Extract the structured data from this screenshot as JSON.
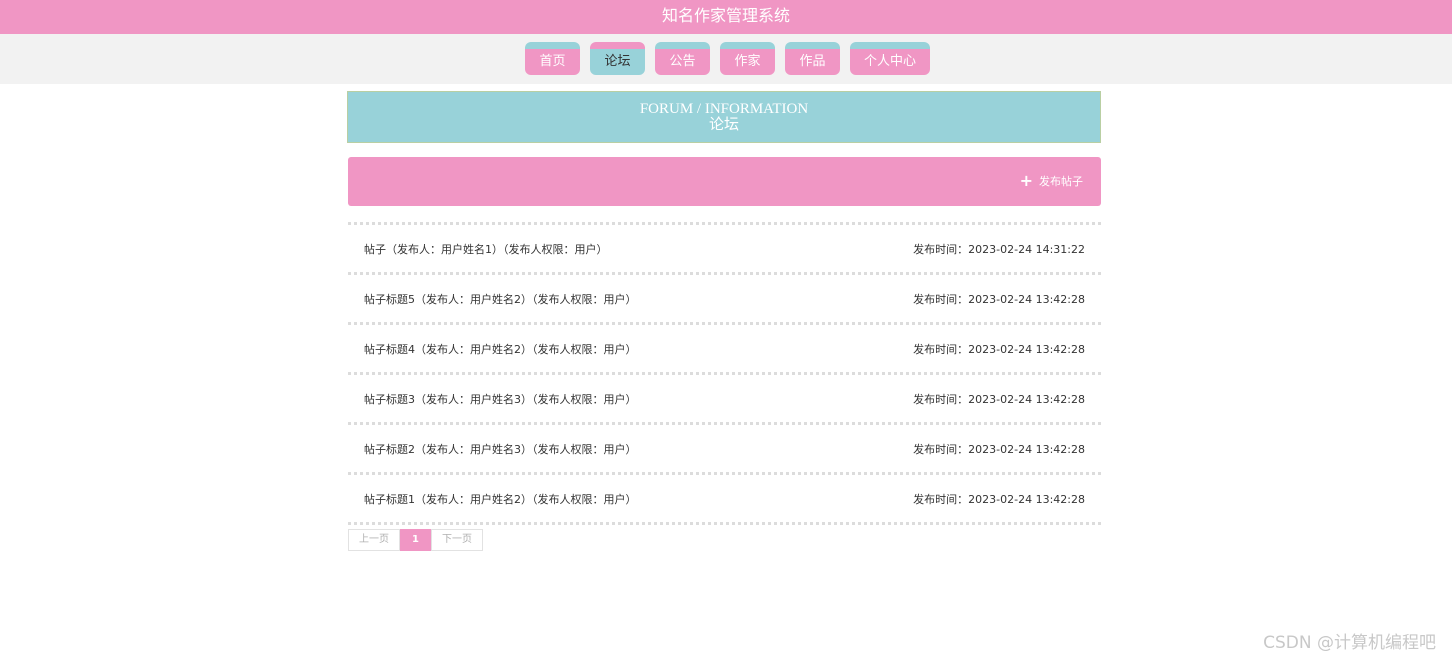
{
  "header": {
    "title": "知名作家管理系统"
  },
  "nav": {
    "items": [
      {
        "label": "首页",
        "active": false
      },
      {
        "label": "论坛",
        "active": true
      },
      {
        "label": "公告",
        "active": false
      },
      {
        "label": "作家",
        "active": false
      },
      {
        "label": "作品",
        "active": false
      },
      {
        "label": "个人中心",
        "active": false
      }
    ]
  },
  "banner": {
    "title_en": "FORUM / INFORMATION",
    "title_cn": "论坛"
  },
  "toolbar": {
    "post_label": "发布帖子"
  },
  "posts": [
    {
      "title": "帖子（发布人：用户姓名1）（发布人权限：用户）",
      "time": "发布时间：2023-02-24 14:31:22"
    },
    {
      "title": "帖子标题5（发布人：用户姓名2）（发布人权限：用户）",
      "time": "发布时间：2023-02-24 13:42:28"
    },
    {
      "title": "帖子标题4（发布人：用户姓名2）（发布人权限：用户）",
      "time": "发布时间：2023-02-24 13:42:28"
    },
    {
      "title": "帖子标题3（发布人：用户姓名3）（发布人权限：用户）",
      "time": "发布时间：2023-02-24 13:42:28"
    },
    {
      "title": "帖子标题2（发布人：用户姓名3）（发布人权限：用户）",
      "time": "发布时间：2023-02-24 13:42:28"
    },
    {
      "title": "帖子标题1（发布人：用户姓名2）（发布人权限：用户）",
      "time": "发布时间：2023-02-24 13:42:28"
    }
  ],
  "pagination": {
    "prev_label": "上一页",
    "current": "1",
    "next_label": "下一页"
  },
  "watermark": "CSDN @计算机编程吧",
  "colors": {
    "primary_pink": "#f096c4",
    "accent_teal": "#98d2d9"
  }
}
